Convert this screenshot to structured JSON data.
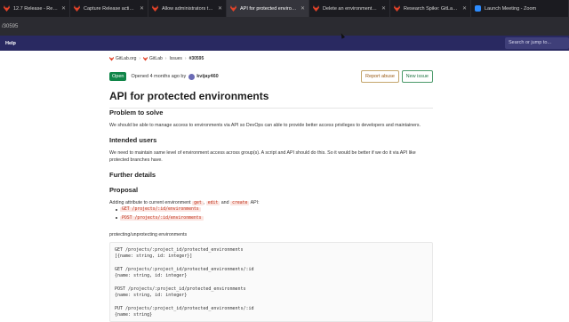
{
  "browser": {
    "tabs": [
      {
        "title": "12.7 Release - Release Manage",
        "icon": "gitlab-icon",
        "active": false
      },
      {
        "title": "Capture Release actions in the",
        "icon": "gitlab-icon",
        "active": false
      },
      {
        "title": "Allow administrators to disable",
        "icon": "gitlab-icon",
        "active": false
      },
      {
        "title": "API for protected environments",
        "icon": "gitlab-icon",
        "active": true
      },
      {
        "title": "Delete an environment via UI (#",
        "icon": "gitlab-icon",
        "active": false
      },
      {
        "title": "Research Spike: GitLab Pages a",
        "icon": "gitlab-icon",
        "active": false
      },
      {
        "title": "Launch Meeting - Zoom",
        "icon": "zoom-icon",
        "active": false
      }
    ],
    "address": "/30595"
  },
  "topnav": {
    "help": "Help",
    "search_placeholder": "Search or jump to..."
  },
  "breadcrumb": {
    "group": "GitLab.org",
    "project": "GitLab",
    "section": "Issues",
    "current": "#30595"
  },
  "issue": {
    "status": "Open",
    "opened_text": "Opened 4 months ago by",
    "author": "kvijay460",
    "report_abuse": "Report abuse",
    "new_issue": "New issue",
    "title": "API for protected environments"
  },
  "description": {
    "problem_heading": "Problem to solve",
    "problem_text": "We should be able to manage access to environments via API so DevOps can able to provide better access privileges to developers and maintainers.",
    "users_heading": "Intended users",
    "users_text": "We need to maintain same level of environment access across group(s). A script and API should do this. So it would be better if we do it via API like protected branches have.",
    "further_heading": "Further details",
    "proposal_heading": "Proposal",
    "adding_prefix": "Adding attribute to current environment",
    "code_get": "get",
    "code_edit": "edit",
    "and_word": "and",
    "code_create": "create",
    "api_suffix": "API:",
    "list": [
      "GET /projects/:id/environments",
      "POST /projects/:id/environments"
    ],
    "protecting_text": "protecting/unprotecting environments",
    "code_block": "GET /projects/:project_id/protected_environments\n[{name: string, id: integer}]\n\nGET /projects/:project_id/protected_environments/:id\n{name: string, id: integer}\n\nPOST /projects/:project_id/protected_environments\n{name: string, id: integer}\n\nPUT /projects/:project_id/protected_environments/:id\n{name: string}"
  },
  "colors": {
    "topnav": "#292961",
    "open_badge": "#108548",
    "code_red": "#c0341d"
  }
}
